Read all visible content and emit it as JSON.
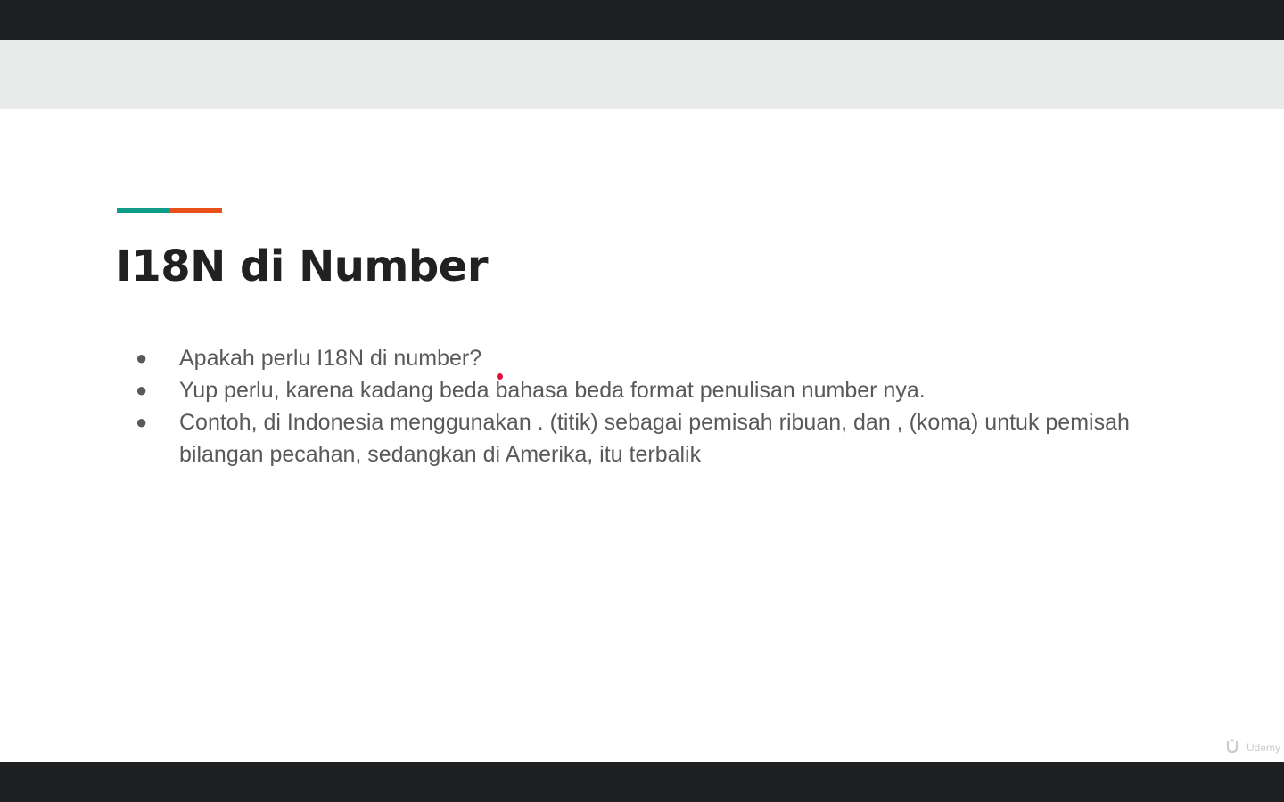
{
  "slide": {
    "title": "I18N di Number",
    "bullets": [
      "Apakah perlu I18N di number?",
      "Yup perlu, karena kadang beda bahasa beda format penulisan number nya.",
      "Contoh, di Indonesia menggunakan . (titik) sebagai pemisah ribuan, dan , (koma) untuk pemisah bilangan pecahan, sedangkan di Amerika, itu terbalik"
    ],
    "bullet_marker": "●"
  },
  "watermark": {
    "brand": "Udemy",
    "icon": "udemy-logo-icon"
  },
  "colors": {
    "accent_teal": "#0f9d8a",
    "accent_orange": "#e8511a",
    "pointer": "#e0103a",
    "frame": "#1e1f21",
    "header_band": "#e8ebea"
  }
}
